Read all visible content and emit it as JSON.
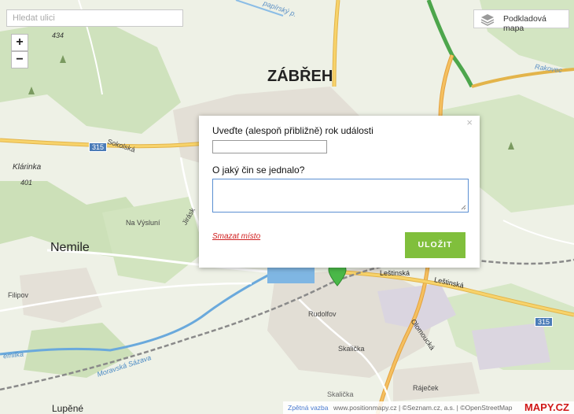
{
  "search": {
    "placeholder": "Hledat ulici"
  },
  "zoom": {
    "in": "+",
    "out": "−"
  },
  "layer_button": {
    "label": "Podkladová mapa",
    "icon": "layers-icon"
  },
  "map": {
    "places": {
      "zabreh": "ZÁBŘEH",
      "nemile": "Nemile",
      "klarinka": "Klárinka",
      "klarinka_elev": "401",
      "elev_434": "434",
      "na_vysluni": "Na Výsluní",
      "filipov": "Filipov",
      "rudolfov": "Rudolfov",
      "skalicka": "Skalička",
      "skalicka2": "Skalička",
      "rajecek": "Ráječek",
      "lupene": "Lupěné"
    },
    "streets": {
      "sokolska": "Sokolská",
      "jiraskova": "Jirásk",
      "lestinska": "Leštinská",
      "lestinska2": "Leštinská",
      "olomoucka": "Olomoucká",
      "rakovec": "Rakovec",
      "papirensky": "papírský p.",
      "moravska_sazava": "Moravská Sázava",
      "emilka": "emilka"
    },
    "road_numbers": {
      "r315a": "315",
      "r315b": "315"
    }
  },
  "popup": {
    "close": "×",
    "q_year": "Uveďte (alespoň přibližně) rok události",
    "q_act": "O jaký čin se jednalo?",
    "year_value": "",
    "act_value": "",
    "delete": "Smazat místo",
    "save": "ULOŽIT"
  },
  "footer": {
    "attrib1": "Zpětná vazba",
    "attrib2": "www.positionmapy.cz | ©Seznam.cz, a.s. | ©OpenStreetMap",
    "logo": "MAPY.CZ"
  },
  "colors": {
    "primary_road": "#f5c85b",
    "motorway": "#4da64c",
    "save_button": "#80bf3c",
    "river": "#5a9fd6",
    "marker": "#4ab848"
  }
}
